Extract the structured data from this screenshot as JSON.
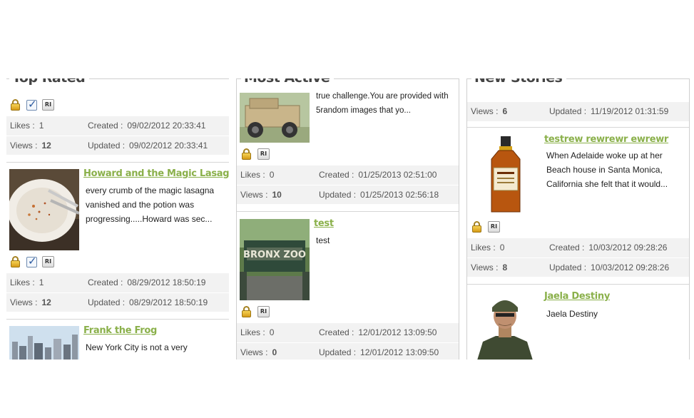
{
  "columns": {
    "top_rated": {
      "heading": "Top Rated",
      "first_card": {
        "likes_label": "Likes :",
        "likes": "1",
        "views_label": "Views :",
        "views": "12",
        "created_label": "Created :",
        "created": "09/02/2012 20:33:41",
        "updated_label": "Updated :",
        "updated": "09/02/2012 20:33:41"
      },
      "stories": [
        {
          "title": "Howard and the Magic Lasagna",
          "text": "every crumb of the magic lasagna vanished and the potion was progressing.....Howard was sec...",
          "likes_label": "Likes :",
          "likes": "1",
          "views_label": "Views :",
          "views": "12",
          "created_label": "Created :",
          "created": "08/29/2012 18:50:19",
          "updated_label": "Updated :",
          "updated": "08/29/2012 18:50:19"
        },
        {
          "title": "Frank the Frog",
          "text": "New York City is not a very"
        }
      ]
    },
    "most_active": {
      "heading": "Most Active",
      "stories": [
        {
          "text": "true challenge.You are provided with 5random images that yo...",
          "likes_label": "Likes :",
          "likes": "0",
          "views_label": "Views :",
          "views": "10",
          "created_label": "Created :",
          "created": "01/25/2013 02:51:00",
          "updated_label": "Updated :",
          "updated": "01/25/2013 02:56:18"
        },
        {
          "title": "test",
          "text": "test",
          "likes_label": "Likes :",
          "likes": "0",
          "views_label": "Views :",
          "views": "0",
          "created_label": "Created :",
          "created": "12/01/2012 13:09:50",
          "updated_label": "Updated :",
          "updated": "12/01/2012 13:09:50"
        }
      ]
    },
    "new_stories": {
      "heading": "New Stories",
      "first_card": {
        "views_label": "Views :",
        "views": "6",
        "updated_label": "Updated :",
        "updated": "11/19/2012 01:31:59"
      },
      "stories": [
        {
          "title": "testrew rewrewr ewrewr",
          "text": "When Adelaide woke up at her Beach house in Santa Monica, California she felt that it would...",
          "likes_label": "Likes :",
          "likes": "0",
          "views_label": "Views :",
          "views": "8",
          "created_label": "Created :",
          "created": "10/03/2012 09:28:26",
          "updated_label": "Updated :",
          "updated": "10/03/2012 09:28:26"
        },
        {
          "title": "Jaela Destiny",
          "text": "Jaela Destiny"
        }
      ]
    }
  },
  "icons": {
    "lock": "lock-icon",
    "check": "checkbox-icon",
    "ri": "ri-badge-icon",
    "ri_text": "RI"
  },
  "colors": {
    "title_link": "#8ab04a",
    "stats_bg": "#f2f2f2",
    "border": "#cfcfcf"
  }
}
